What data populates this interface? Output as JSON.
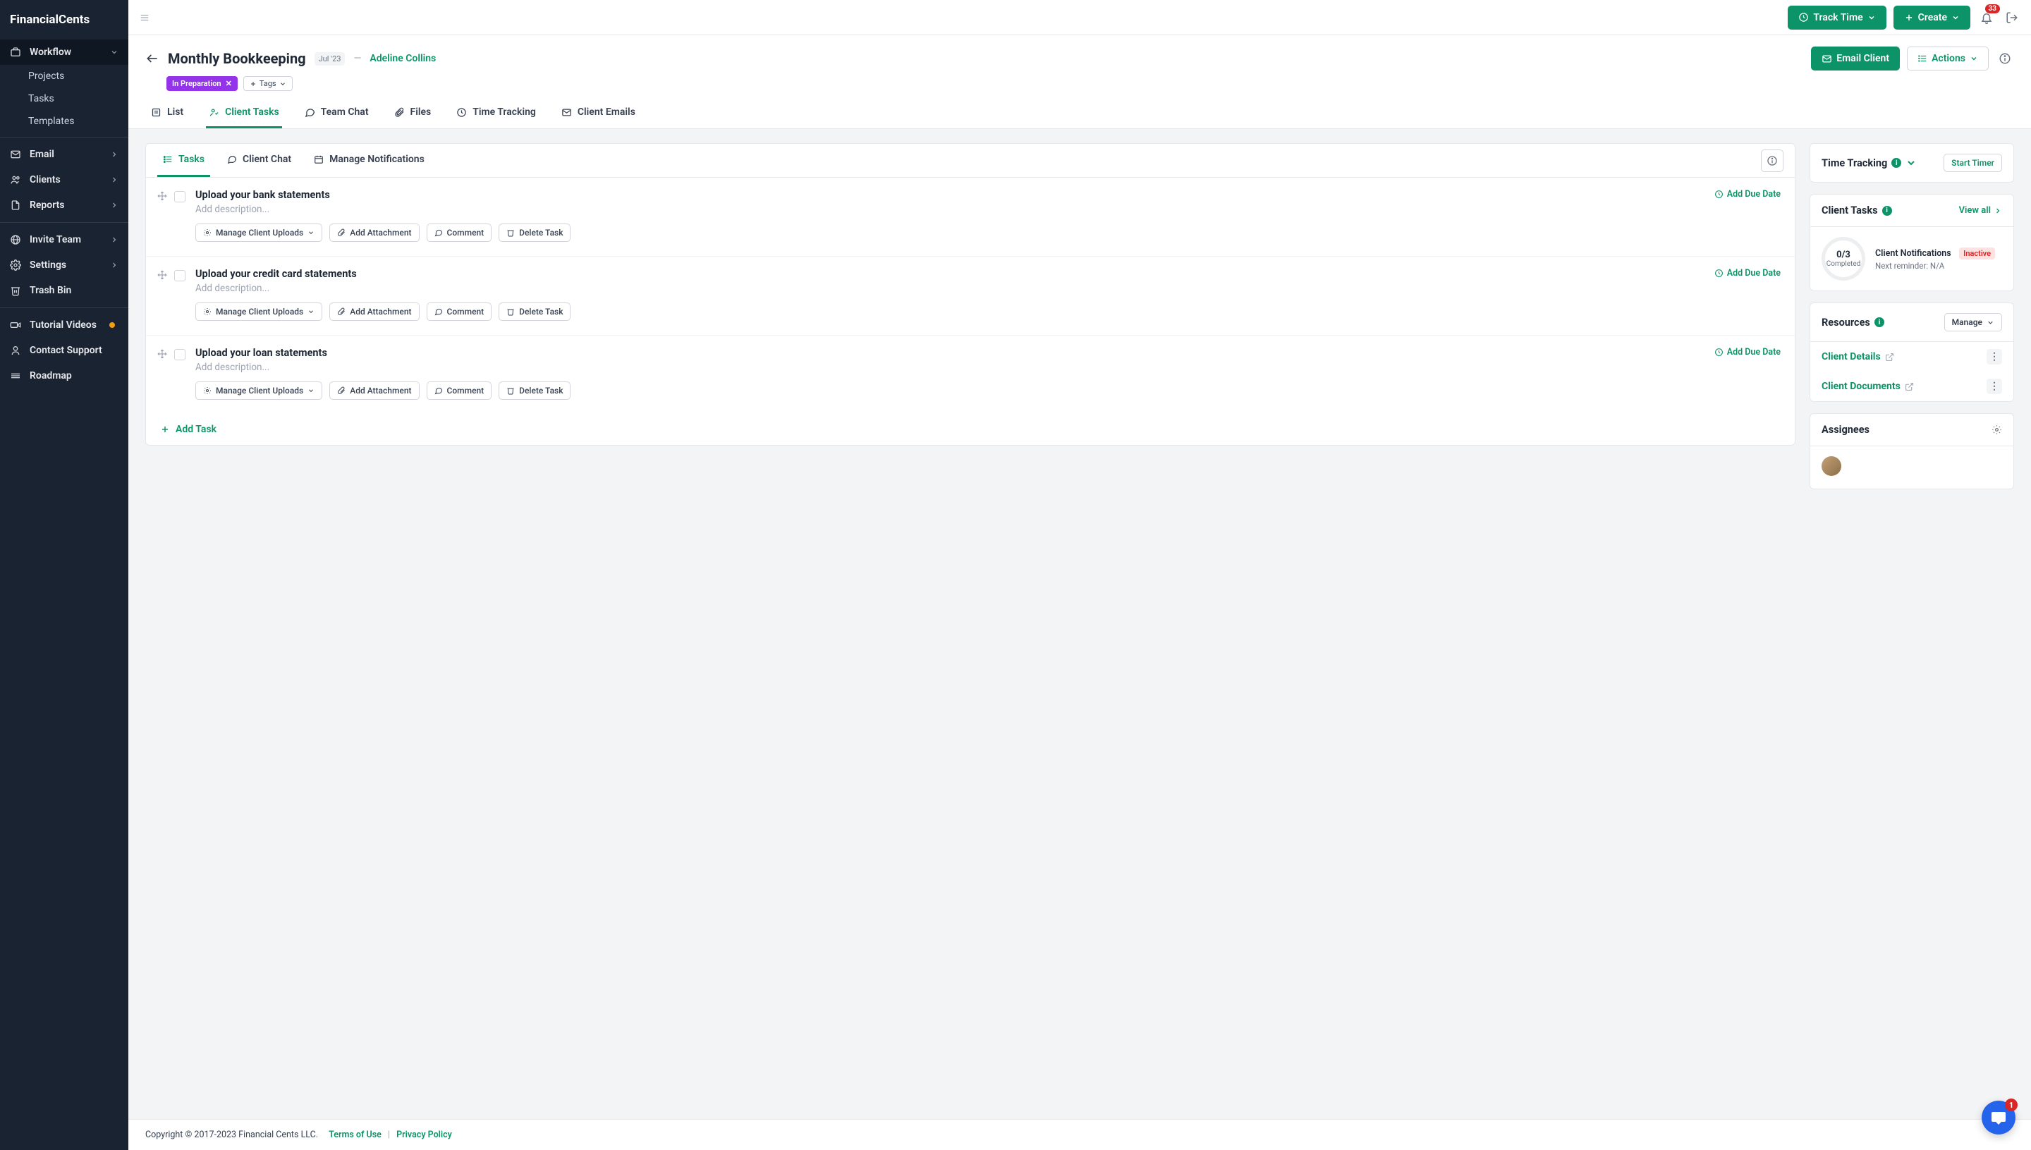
{
  "app": {
    "name": "FinancialCents"
  },
  "sidebar": {
    "workflow": {
      "label": "Workflow",
      "sub": [
        "Projects",
        "Tasks",
        "Templates"
      ]
    },
    "items": [
      {
        "label": "Email"
      },
      {
        "label": "Clients"
      },
      {
        "label": "Reports"
      }
    ],
    "footer_items": [
      {
        "label": "Invite Team"
      },
      {
        "label": "Settings"
      }
    ],
    "trash": "Trash Bin",
    "bottom": [
      {
        "label": "Tutorial Videos"
      },
      {
        "label": "Contact Support"
      },
      {
        "label": "Roadmap"
      }
    ]
  },
  "topbar": {
    "track_time": "Track Time",
    "create": "Create",
    "notif_count": "33"
  },
  "header": {
    "title": "Monthly Bookkeeping",
    "date": "Jul '23",
    "dash": "—",
    "client": "Adeline Collins",
    "status": "In Preparation",
    "tags_label": "Tags",
    "email_client": "Email Client",
    "actions": "Actions",
    "tabs": [
      "List",
      "Client Tasks",
      "Team Chat",
      "Files",
      "Time Tracking",
      "Client Emails"
    ]
  },
  "subtabs": [
    "Tasks",
    "Client Chat",
    "Manage Notifications"
  ],
  "task_common": {
    "desc_placeholder": "Add description...",
    "manage_uploads": "Manage Client Uploads",
    "add_attachment": "Add Attachment",
    "comment": "Comment",
    "delete": "Delete Task",
    "add_due": "Add Due Date"
  },
  "tasks": [
    {
      "title": "Upload your bank statements"
    },
    {
      "title": "Upload your credit card statements"
    },
    {
      "title": "Upload your loan statements"
    }
  ],
  "add_task": "Add Task",
  "side": {
    "time_tracking": {
      "title": "Time Tracking",
      "start_timer": "Start Timer"
    },
    "client_tasks": {
      "title": "Client Tasks",
      "view_all": "View all",
      "frac": "0/3",
      "completed": "Completed",
      "notif_title": "Client Notifications",
      "inactive": "Inactive",
      "reminder": "Next reminder: N/A"
    },
    "resources": {
      "title": "Resources",
      "manage": "Manage",
      "links": [
        "Client Details",
        "Client Documents"
      ]
    },
    "assignees": {
      "title": "Assignees"
    }
  },
  "footer": {
    "copyright": "Copyright © 2017-2023 Financial Cents LLC.",
    "terms": "Terms of Use",
    "privacy": "Privacy Policy"
  },
  "chat_badge": "1"
}
